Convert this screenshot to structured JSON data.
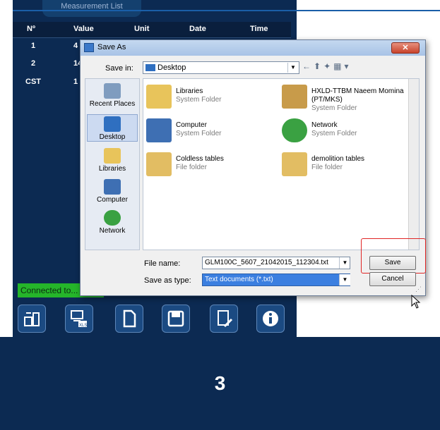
{
  "app": {
    "tab_label": "Measurement List",
    "columns": [
      "Nº",
      "Value",
      "Unit",
      "Date",
      "Time"
    ],
    "rows": [
      {
        "n": "1",
        "value": "4"
      },
      {
        "n": "2",
        "value": "14"
      },
      {
        "n": "CST",
        "value": "1"
      }
    ],
    "status": "Connected to..."
  },
  "toolbar": {
    "icons": [
      "transfer-device-icon",
      "export-excel-icon",
      "new-document-icon",
      "save-icon",
      "clear-icon",
      "info-icon"
    ]
  },
  "dialog": {
    "title": "Save As",
    "close_label": "✕",
    "save_in_label": "Save in:",
    "save_in_value": "Desktop",
    "places": [
      "Recent Places",
      "Desktop",
      "Libraries",
      "Computer",
      "Network"
    ],
    "files": [
      {
        "name": "Libraries",
        "type": "System Folder"
      },
      {
        "name": "HXLD-TTBM Naeem Momina",
        "name2": "(PT/MKS)",
        "type": "System Folder"
      },
      {
        "name": "Computer",
        "type": "System Folder"
      },
      {
        "name": "Network",
        "type": "System Folder"
      },
      {
        "name": "Coldless tables",
        "type": "File folder"
      },
      {
        "name": "demolition tables",
        "type": "File folder"
      }
    ],
    "filename_label": "File name:",
    "filename_value": "GLM100C_5607_21042015_112304.txt",
    "savetype_label": "Save as type:",
    "savetype_value": "Text documents (*.txt)",
    "save_label": "Save",
    "cancel_label": "Cancel"
  },
  "banner": {
    "step": "3"
  },
  "colors": {
    "app_bg": "#0c2a52",
    "status_green": "#25b52a",
    "highlight_red": "#e02525"
  }
}
